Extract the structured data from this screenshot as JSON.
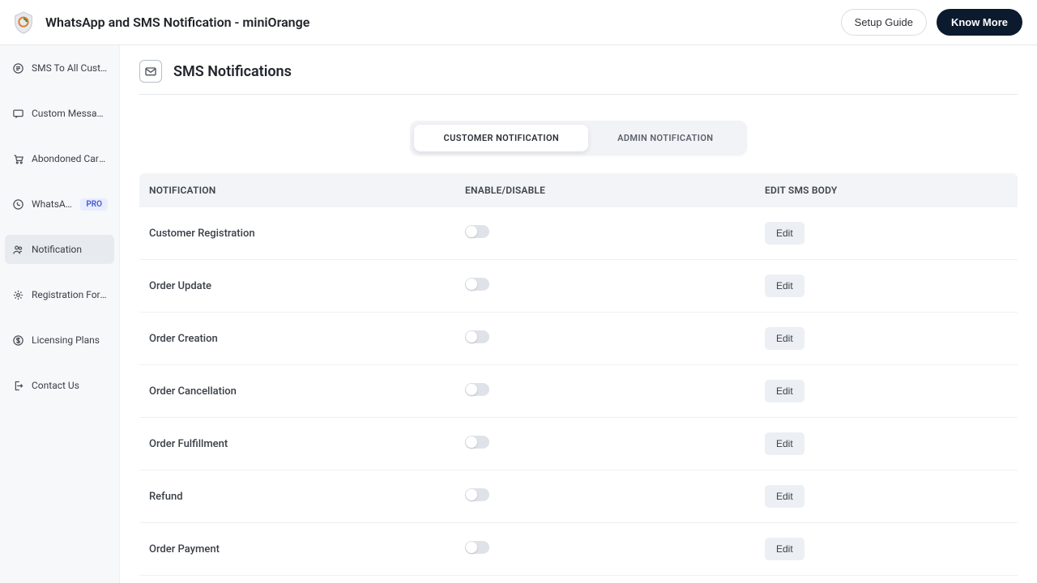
{
  "header": {
    "title": "WhatsApp and SMS Notification - miniOrange",
    "setup_guide": "Setup Guide",
    "know_more": "Know More"
  },
  "sidebar": {
    "items": [
      {
        "label": "SMS To All Customers",
        "icon": "chat-icon"
      },
      {
        "label": "Custom Messages",
        "icon": "message-icon"
      },
      {
        "label": "Abondoned Cart Noti...",
        "icon": "cart-icon"
      },
      {
        "label": "WhatsApp",
        "icon": "whatsapp-icon",
        "badge": "PRO"
      },
      {
        "label": "Notification",
        "icon": "users-icon",
        "active": true
      },
      {
        "label": "Registration Form Set...",
        "icon": "gear-icon"
      },
      {
        "label": "Licensing Plans",
        "icon": "dollar-icon"
      },
      {
        "label": "Contact Us",
        "icon": "signout-icon"
      }
    ]
  },
  "page": {
    "title": "SMS Notifications"
  },
  "tabs": {
    "customer": "CUSTOMER NOTIFICATION",
    "admin": "ADMIN NOTIFICATION"
  },
  "table": {
    "columns": {
      "notification": "NOTIFICATION",
      "enable": "ENABLE/DISABLE",
      "edit": "EDIT SMS BODY"
    },
    "edit_label": "Edit",
    "rows": [
      {
        "name": "Customer Registration"
      },
      {
        "name": "Order Update"
      },
      {
        "name": "Order Creation"
      },
      {
        "name": "Order Cancellation"
      },
      {
        "name": "Order Fulfillment"
      },
      {
        "name": "Refund"
      },
      {
        "name": "Order Payment"
      }
    ]
  }
}
